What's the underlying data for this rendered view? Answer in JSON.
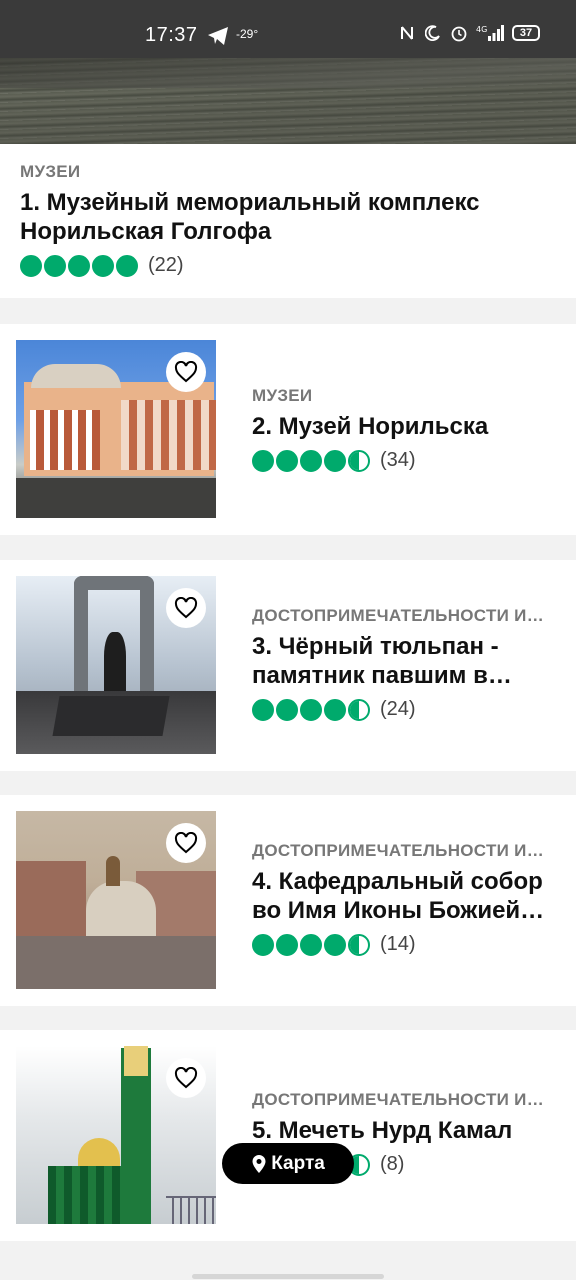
{
  "status_bar": {
    "time": "17:37",
    "temperature": "-29°",
    "network": "4G",
    "battery": "37"
  },
  "colors": {
    "rating_green": "#00aa6c",
    "category_gray": "#777777",
    "map_button_bg": "#000000"
  },
  "hero": {
    "category": "МУЗЕИ",
    "title": "1. Музейный мемориальный комплекс Норильская Голгофа",
    "rating": 5,
    "reviews": "(22)"
  },
  "items": [
    {
      "category": "МУЗЕИ",
      "title": "2. Музей Норильска",
      "rating": 4.5,
      "reviews": "(34)",
      "favorite_icon": "heart-outline-icon"
    },
    {
      "category": "ДОСТОПРИМЕЧАТЕЛЬНОСТИ И…",
      "title": "3. Чёрный тюльпан - памятник павшим в…",
      "rating": 4.5,
      "reviews": "(24)",
      "favorite_icon": "heart-outline-icon"
    },
    {
      "category": "ДОСТОПРИМЕЧАТЕЛЬНОСТИ И…",
      "title": "4. Кафедральный собор во Имя Иконы Божией…",
      "rating": 4.5,
      "reviews": "(14)",
      "favorite_icon": "heart-outline-icon"
    },
    {
      "category": "ДОСТОПРИМЕЧАТЕЛЬНОСТИ И…",
      "title": "5. Мечеть Нурд Камал",
      "rating": 4.5,
      "reviews": "(8)",
      "favorite_icon": "heart-outline-icon"
    }
  ],
  "map_button": {
    "label": "Карта",
    "icon": "map-pin-icon"
  }
}
